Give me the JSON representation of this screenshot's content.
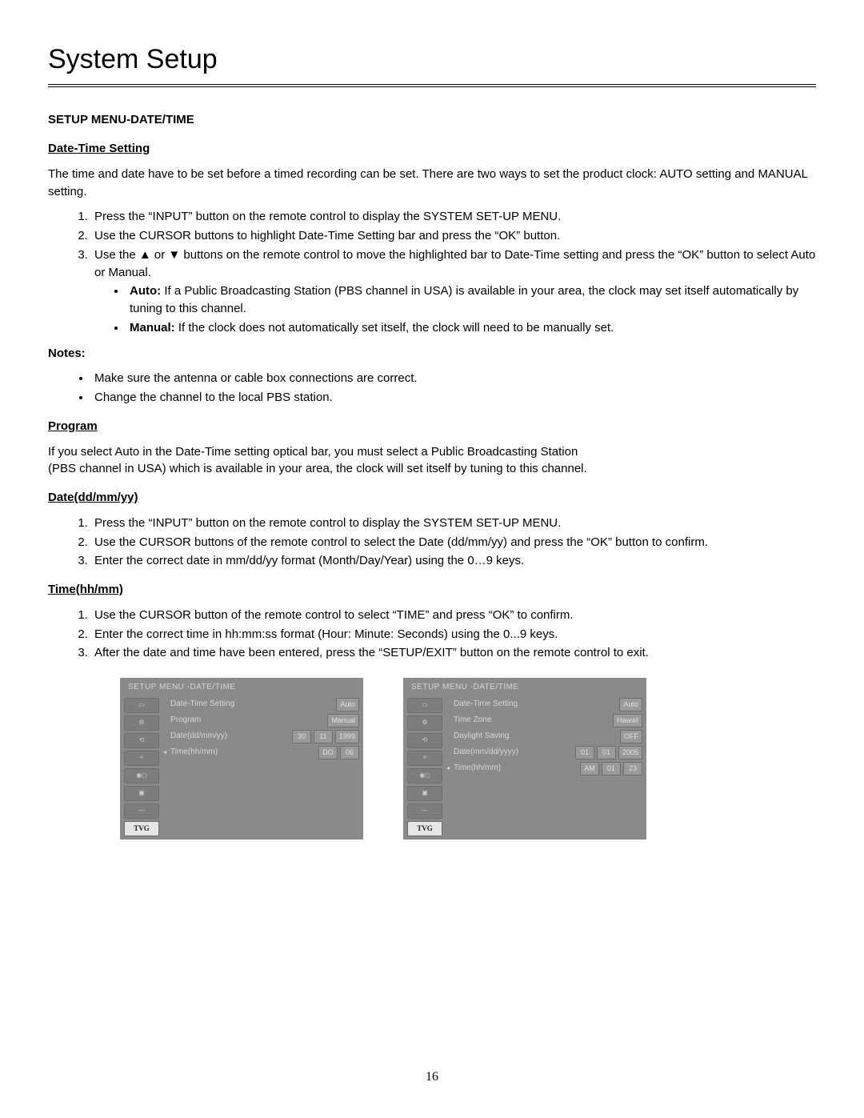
{
  "page_title": "System Setup",
  "setup_heading": "SETUP MENU-DATE/TIME",
  "datetime": {
    "heading": "Date-Time Setting",
    "intro": "The time and date have to be set before a timed recording can be set.  There are two ways to set the product clock: AUTO setting and MANUAL setting.",
    "steps": [
      "Press the “INPUT” button on the remote control to display the SYSTEM SET-UP MENU.",
      "Use the CURSOR buttons to highlight Date-Time Setting bar and press the “OK” button.",
      "Use the ▲ or ▼ buttons on the remote control to move the highlighted bar to Date-Time setting and press the “OK” button to select Auto or Manual."
    ],
    "sub": {
      "auto_label": "Auto:",
      "auto_text": " If a Public Broadcasting Station (PBS channel in USA) is available in your area, the clock may set itself automatically by tuning to this channel.",
      "manual_label": "Manual:",
      "manual_text": " If the clock does not automatically set itself, the clock will need to be manually set."
    }
  },
  "notes": {
    "heading": "Notes:",
    "items": [
      "Make sure the antenna or cable box connections are correct.",
      "Change the channel to the local PBS station."
    ]
  },
  "program": {
    "heading": "Program",
    "line1": "If you select Auto in the Date-Time setting optical bar, you must select a Public Broadcasting Station",
    "line2": "(PBS channel in USA) which is available in your area, the clock will set itself by tuning to this channel."
  },
  "date_section": {
    "heading": "Date(dd/mm/yy)",
    "steps": [
      "Press the “INPUT” button on the remote control to display the SYSTEM SET-UP MENU.",
      "Use the CURSOR buttons of the remote control to select the Date (dd/mm/yy) and press the “OK” button to confirm.",
      "Enter the correct date in mm/dd/yy format (Month/Day/Year) using the 0…9 keys."
    ]
  },
  "time_section": {
    "heading": "Time(hh/mm)",
    "steps": [
      "Use the CURSOR button of the remote control to select “TIME” and press “OK” to confirm.",
      "Enter the correct time in hh:mm:ss format (Hour: Minute: Seconds) using the 0...9 keys.",
      "After the date and time have been entered, press the “SETUP/EXIT” button on the remote control to exit."
    ]
  },
  "osd_common": {
    "title": "SETUP MENU -DATE/TIME",
    "side_icons": [
      "▭",
      "⚙",
      "⟲",
      "✧",
      "◉◻",
      "▣",
      "—"
    ],
    "tvg": "TVG"
  },
  "osd_left": {
    "rows": [
      {
        "arrow": "",
        "label": "Date-Time Setting",
        "vals": [
          "Auto"
        ]
      },
      {
        "arrow": "",
        "label": "Program",
        "vals": [
          "Manual"
        ]
      },
      {
        "arrow": "",
        "label": "Date(dd/mm/yy)",
        "vals": [
          "30",
          "11",
          "1999"
        ]
      },
      {
        "arrow": "◂",
        "label": "Time(hh/mm)",
        "vals": [
          "DO",
          "06"
        ]
      }
    ]
  },
  "osd_right": {
    "rows": [
      {
        "arrow": "",
        "label": "Date-Time Setting",
        "vals": [
          "Auto"
        ]
      },
      {
        "arrow": "",
        "label": "Time Zone",
        "vals": [
          "Hawaii"
        ]
      },
      {
        "arrow": "",
        "label": "Daylight Saving",
        "vals": [
          "OFF"
        ]
      },
      {
        "arrow": "",
        "label": "Date(mm/dd/yyyy)",
        "vals": [
          "01",
          "01",
          "2005"
        ]
      },
      {
        "arrow": "◂",
        "label": "Time(hh/mm)",
        "vals": [
          "AM",
          "01",
          "23"
        ]
      }
    ]
  },
  "page_number": "16"
}
